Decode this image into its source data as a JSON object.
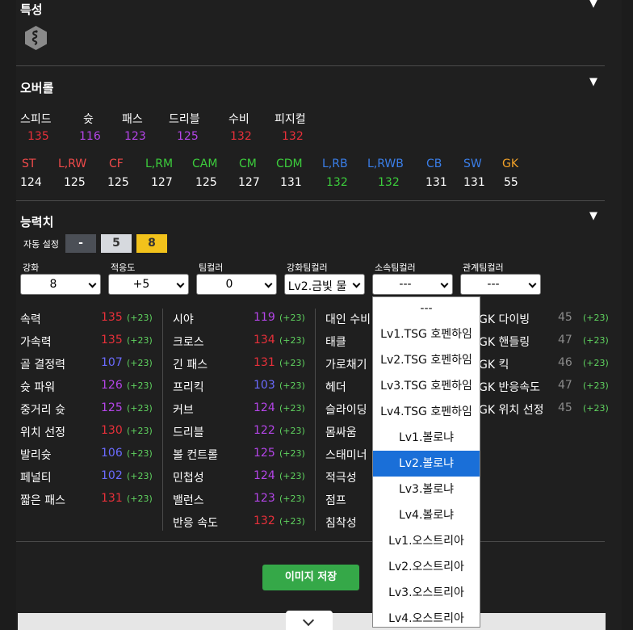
{
  "traits": {
    "title": "특성",
    "icon": "snake-trait-icon"
  },
  "overall": {
    "title": "오버롤",
    "stats": [
      {
        "name": "스피드",
        "value": "135",
        "color": "#e8303a"
      },
      {
        "name": "슛",
        "value": "116",
        "color": "#b445e8"
      },
      {
        "name": "패스",
        "value": "123",
        "color": "#b445e8"
      },
      {
        "name": "드리블",
        "value": "125",
        "color": "#b445e8"
      },
      {
        "name": "수비",
        "value": "132",
        "color": "#e8303a"
      },
      {
        "name": "피지컬",
        "value": "132",
        "color": "#e8303a"
      }
    ],
    "positions": [
      {
        "name": "ST",
        "value": "124",
        "color": "#f04a4a"
      },
      {
        "name": "L,RW",
        "value": "125",
        "color": "#f04a4a"
      },
      {
        "name": "CF",
        "value": "125",
        "color": "#f04a4a"
      },
      {
        "name": "L,RM",
        "value": "127",
        "color": "#3ccd3c"
      },
      {
        "name": "CAM",
        "value": "125",
        "color": "#3ccd3c"
      },
      {
        "name": "CM",
        "value": "127",
        "color": "#3ccd3c"
      },
      {
        "name": "CDM",
        "value": "131",
        "color": "#3ccd3c"
      },
      {
        "name": "L,RB",
        "value": "132",
        "color": "#3a7ee8",
        "value_color": "#3ccd3c"
      },
      {
        "name": "L,RWB",
        "value": "132",
        "color": "#3a7ee8",
        "value_color": "#3ccd3c"
      },
      {
        "name": "CB",
        "value": "131",
        "color": "#3a7ee8"
      },
      {
        "name": "SW",
        "value": "131",
        "color": "#3a7ee8"
      },
      {
        "name": "GK",
        "value": "55",
        "color": "#f0a028"
      }
    ]
  },
  "abilities": {
    "title": "능력치",
    "auto_label": "자동 설정",
    "auto_buttons": [
      "-",
      "5",
      "8"
    ],
    "selects": [
      {
        "label": "강화",
        "value": "8"
      },
      {
        "label": "적응도",
        "value": "+5"
      },
      {
        "label": "팀컬러",
        "value": "0"
      },
      {
        "label": "강화팀컬러",
        "value": "Lv2.금빛 물"
      },
      {
        "label": "소속팀컬러",
        "value": "---"
      },
      {
        "label": "관계팀컬러",
        "value": "---"
      }
    ],
    "col1": [
      {
        "name": "속력",
        "value": "135",
        "bonus": "(+23)",
        "color": "#e8303a"
      },
      {
        "name": "가속력",
        "value": "135",
        "bonus": "(+23)",
        "color": "#e8303a"
      },
      {
        "name": "골 결정력",
        "value": "107",
        "bonus": "(+23)",
        "color": "#6b6bff"
      },
      {
        "name": "슛 파워",
        "value": "126",
        "bonus": "(+23)",
        "color": "#b445e8"
      },
      {
        "name": "중거리 슛",
        "value": "125",
        "bonus": "(+23)",
        "color": "#b445e8"
      },
      {
        "name": "위치 선정",
        "value": "130",
        "bonus": "(+23)",
        "color": "#e8303a"
      },
      {
        "name": "발리슛",
        "value": "106",
        "bonus": "(+23)",
        "color": "#6b6bff"
      },
      {
        "name": "페널티",
        "value": "102",
        "bonus": "(+23)",
        "color": "#6b6bff"
      },
      {
        "name": "짧은 패스",
        "value": "131",
        "bonus": "(+23)",
        "color": "#e8303a"
      }
    ],
    "col2": [
      {
        "name": "시야",
        "value": "119",
        "bonus": "(+23)",
        "color": "#b445e8"
      },
      {
        "name": "크로스",
        "value": "134",
        "bonus": "(+23)",
        "color": "#e8303a"
      },
      {
        "name": "긴 패스",
        "value": "131",
        "bonus": "(+23)",
        "color": "#e8303a"
      },
      {
        "name": "프리킥",
        "value": "103",
        "bonus": "(+23)",
        "color": "#6b6bff"
      },
      {
        "name": "커브",
        "value": "124",
        "bonus": "(+23)",
        "color": "#b445e8"
      },
      {
        "name": "드리블",
        "value": "122",
        "bonus": "(+23)",
        "color": "#b445e8"
      },
      {
        "name": "볼 컨트롤",
        "value": "125",
        "bonus": "(+23)",
        "color": "#b445e8"
      },
      {
        "name": "민첩성",
        "value": "124",
        "bonus": "(+23)",
        "color": "#b445e8"
      },
      {
        "name": "밸런스",
        "value": "123",
        "bonus": "(+23)",
        "color": "#b445e8"
      },
      {
        "name": "반응 속도",
        "value": "132",
        "bonus": "(+23)",
        "color": "#e8303a"
      }
    ],
    "col3": [
      {
        "name": "대인 수비"
      },
      {
        "name": "태클"
      },
      {
        "name": "가로채기"
      },
      {
        "name": "헤더"
      },
      {
        "name": "슬라이딩"
      },
      {
        "name": "몸싸움"
      },
      {
        "name": "스태미너"
      },
      {
        "name": "적극성"
      },
      {
        "name": "점프"
      },
      {
        "name": "침착성"
      }
    ],
    "col4": [
      {
        "name": "GK 다이빙",
        "value": "45",
        "bonus": "(+23)",
        "color": "#8a8a8a"
      },
      {
        "name": "GK 핸들링",
        "value": "47",
        "bonus": "(+23)",
        "color": "#8a8a8a"
      },
      {
        "name": "GK 킥",
        "value": "46",
        "bonus": "(+23)",
        "color": "#8a8a8a"
      },
      {
        "name": "GK 반응속도",
        "value": "47",
        "bonus": "(+23)",
        "color": "#8a8a8a"
      },
      {
        "name": "GK 위치 선정",
        "value": "45",
        "bonus": "(+23)",
        "color": "#8a8a8a"
      }
    ]
  },
  "dropdown": {
    "options": [
      "---",
      "Lv1.TSG 호펜하임",
      "Lv2.TSG 호펜하임",
      "Lv3.TSG 호펜하임",
      "Lv4.TSG 호펜하임",
      "Lv1.볼로냐",
      "Lv2.볼로냐",
      "Lv3.볼로냐",
      "Lv4.볼로냐",
      "Lv1.오스트리아",
      "Lv2.오스트리아",
      "Lv3.오스트리아",
      "Lv4.오스트리아"
    ],
    "selected_index": 6
  },
  "save_button": "이미지 저장"
}
